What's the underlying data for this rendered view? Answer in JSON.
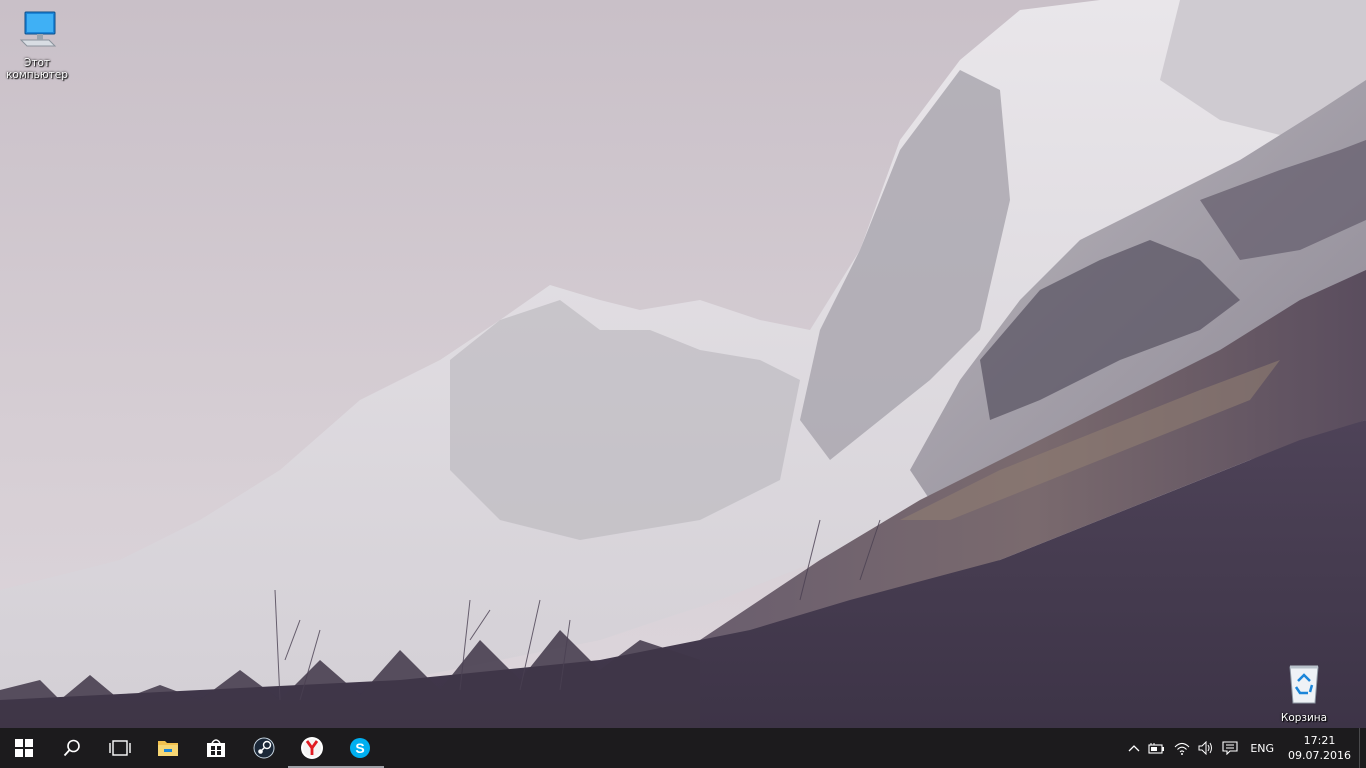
{
  "desktop": {
    "icons": {
      "this_pc": "Этот компьютер",
      "this_pc_line1": "Этот",
      "this_pc_line2": "компьютер",
      "recycle_bin": "Корзина"
    }
  },
  "taskbar": {
    "pinned": [
      {
        "name": "start",
        "icon": "windows-logo-icon"
      },
      {
        "name": "search",
        "icon": "search-icon"
      },
      {
        "name": "task-view",
        "icon": "task-view-icon"
      },
      {
        "name": "file-explorer",
        "icon": "folder-icon"
      },
      {
        "name": "store",
        "icon": "store-icon"
      },
      {
        "name": "steam",
        "icon": "steam-icon"
      },
      {
        "name": "yandex-browser",
        "icon": "yandex-icon",
        "running": true
      },
      {
        "name": "skype",
        "icon": "skype-icon",
        "running": true
      }
    ],
    "tray": {
      "language": "ENG",
      "time": "17:21",
      "date": "09.07.2016"
    }
  },
  "colors": {
    "taskbar_bg": "#1c1b1d",
    "skype": "#00aff0",
    "yandex_red": "#e11b22"
  }
}
